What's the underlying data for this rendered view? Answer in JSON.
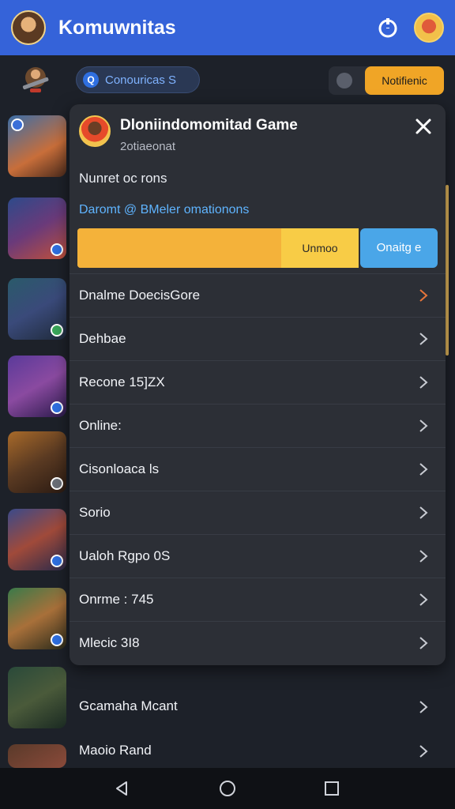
{
  "header": {
    "title": "Komuwnitas"
  },
  "subbar": {
    "community_label": "Conouricas S",
    "notification_label": "Notifienic"
  },
  "game_card": {
    "title": "Dloniindomomitad Game",
    "subtitle": "2otiaeonat",
    "numbers": "Nunret oc rons",
    "link_text": "Daromt @ BMeler omationons",
    "progress_fraction": 0.8,
    "join_label": "Unmoo",
    "online_label": "Onaitg e"
  },
  "menu": [
    {
      "label": "Dnalme DoecisGore",
      "accent": "#e8763a"
    },
    {
      "label": "Dehbae",
      "accent": "#c9ccd3"
    },
    {
      "label": "Recone 15]ZX",
      "accent": "#c9ccd3"
    },
    {
      "label": "Online:",
      "accent": "#c9ccd3"
    },
    {
      "label": "Cisonloaca ls",
      "accent": "#c9ccd3"
    },
    {
      "label": "Sorio",
      "accent": "#c9ccd3"
    },
    {
      "label": "Ualoh Rgpo 0S",
      "accent": "#c9ccd3"
    },
    {
      "label": "Onrme : 745",
      "accent": "#c9ccd3"
    },
    {
      "label": "Mlecic 3I8",
      "accent": "#c9ccd3"
    }
  ],
  "outside_rows": [
    {
      "label": "Gcamaha Mcant"
    },
    {
      "label": "Maoio Rand"
    }
  ],
  "colors": {
    "appbar": "#3563d9",
    "background": "#1d2129",
    "panel": "#2c2f36",
    "accent_orange": "#f0a526",
    "accent_blue": "#4aa6e8"
  }
}
